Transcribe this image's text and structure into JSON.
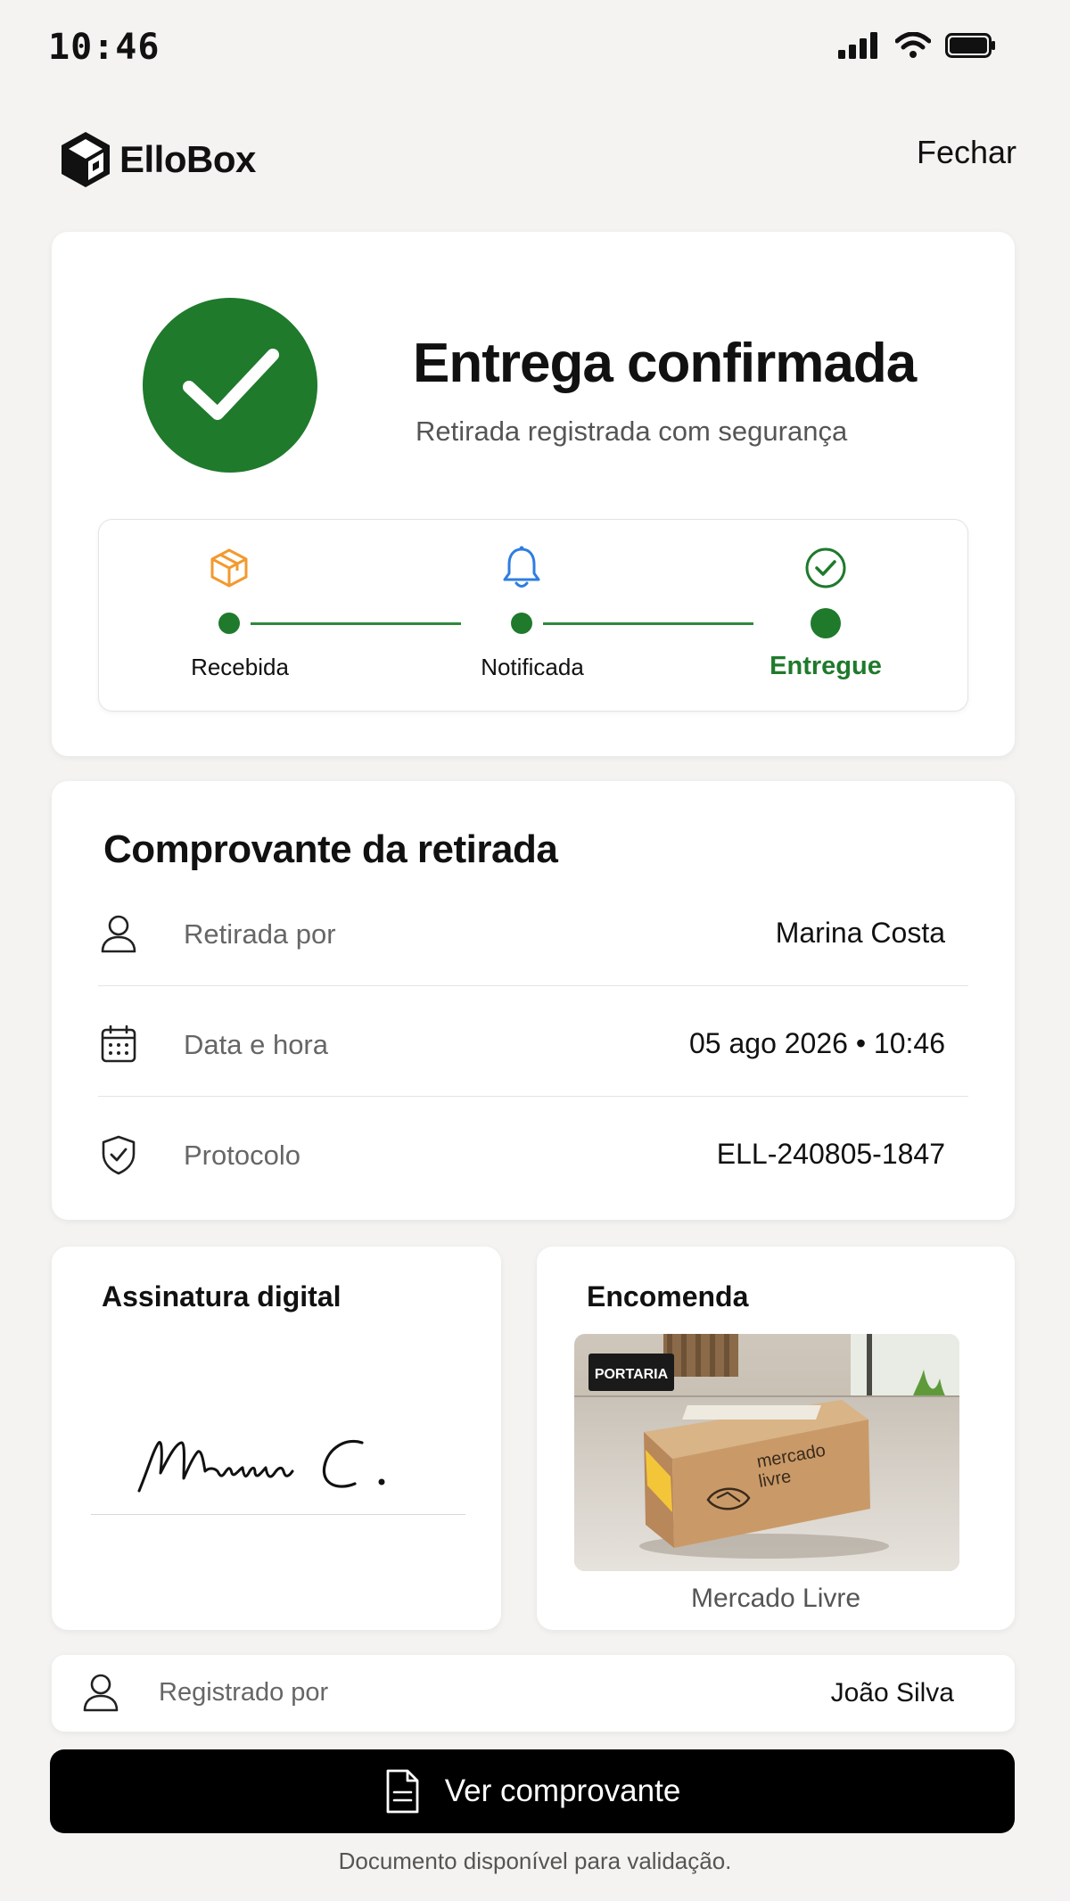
{
  "status_bar": {
    "time": "10:46"
  },
  "header": {
    "brand": "ElloBox",
    "close_label": "Fechar"
  },
  "hero": {
    "title": "Entrega confirmada",
    "subtitle": "Retirada registrada com segurança",
    "steps": [
      {
        "label": "Recebida",
        "icon": "package-icon"
      },
      {
        "label": "Notificada",
        "icon": "bell-icon"
      },
      {
        "label": "Entregue",
        "icon": "check-circle-icon",
        "active": true
      }
    ],
    "colors": {
      "success": "#1f7a2c",
      "package": "#f29a2e",
      "bell": "#2f7de1"
    }
  },
  "receipt": {
    "title": "Comprovante da retirada",
    "rows": [
      {
        "label": "Retirada por",
        "value": "Marina Costa",
        "icon": "user-icon"
      },
      {
        "label": "Data e hora",
        "value": "05 ago 2026 • 10:46",
        "icon": "calendar-icon"
      },
      {
        "label": "Protocolo",
        "value": "ELL-240805-1847",
        "icon": "shield-check-icon"
      }
    ]
  },
  "signature": {
    "title": "Assinatura digital",
    "text": "Marina C."
  },
  "package": {
    "title": "Encomenda",
    "caption": "Mercado Livre",
    "photo_sign": "PORTARIA",
    "box_brand_line1": "mercado",
    "box_brand_line2": "livre"
  },
  "registered": {
    "label": "Registrado por",
    "value": "João Silva"
  },
  "action": {
    "button_label": "Ver comprovante"
  },
  "footnote": "Documento disponível para validação."
}
